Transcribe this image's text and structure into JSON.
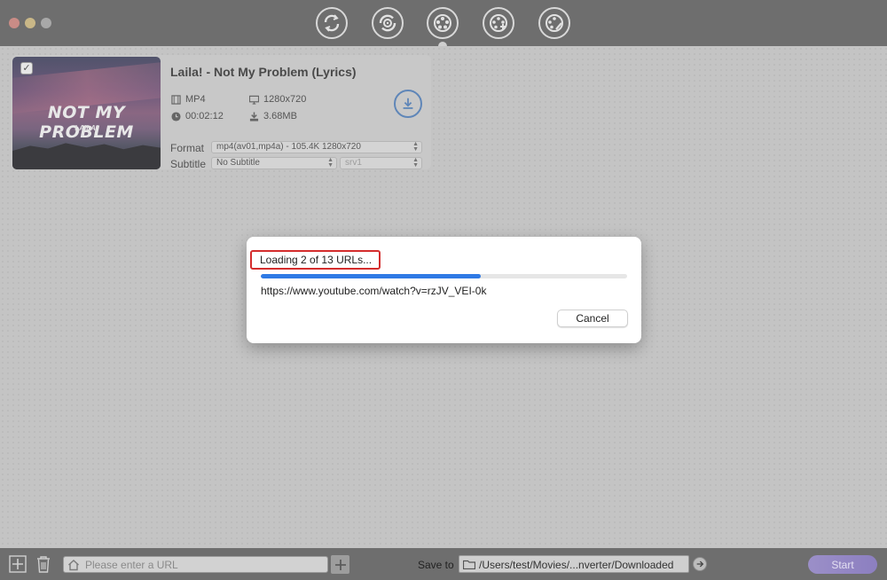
{
  "window": {
    "controls": [
      "close",
      "minimize",
      "zoom"
    ]
  },
  "toolbar": {
    "tools": [
      {
        "icon": "convert-icon"
      },
      {
        "icon": "burn-icon"
      },
      {
        "icon": "download-video-icon",
        "active": true
      },
      {
        "icon": "merge-video-icon"
      },
      {
        "icon": "edit-video-icon"
      }
    ]
  },
  "video_item": {
    "checked": true,
    "thumbnail_title": "NOT MY PROBLEM",
    "thumbnail_subtitle": "LAILA!",
    "title": "Laila! - Not My Problem (Lyrics)",
    "container": "MP4",
    "resolution": "1280x720",
    "duration": "00:02:12",
    "size": "3.68MB",
    "format_label": "Format",
    "format_value": "mp4(av01,mp4a) - 105.4K 1280x720",
    "subtitle_label": "Subtitle",
    "subtitle_value": "No Subtitle",
    "subtitle_track": "srv1"
  },
  "dialog": {
    "status": "Loading 2 of 13 URLs...",
    "progress_fraction": 0.6,
    "current_url": "https://www.youtube.com/watch?v=rzJV_VEI-0k",
    "cancel_label": "Cancel",
    "highlight_color": "#d42d2d",
    "progress_color": "#2f7ae5"
  },
  "bottombar": {
    "url_placeholder": "Please enter a URL",
    "save_to_label": "Save to",
    "save_path": "/Users/test/Movies/...nverter/Downloaded",
    "start_label": "Start"
  }
}
